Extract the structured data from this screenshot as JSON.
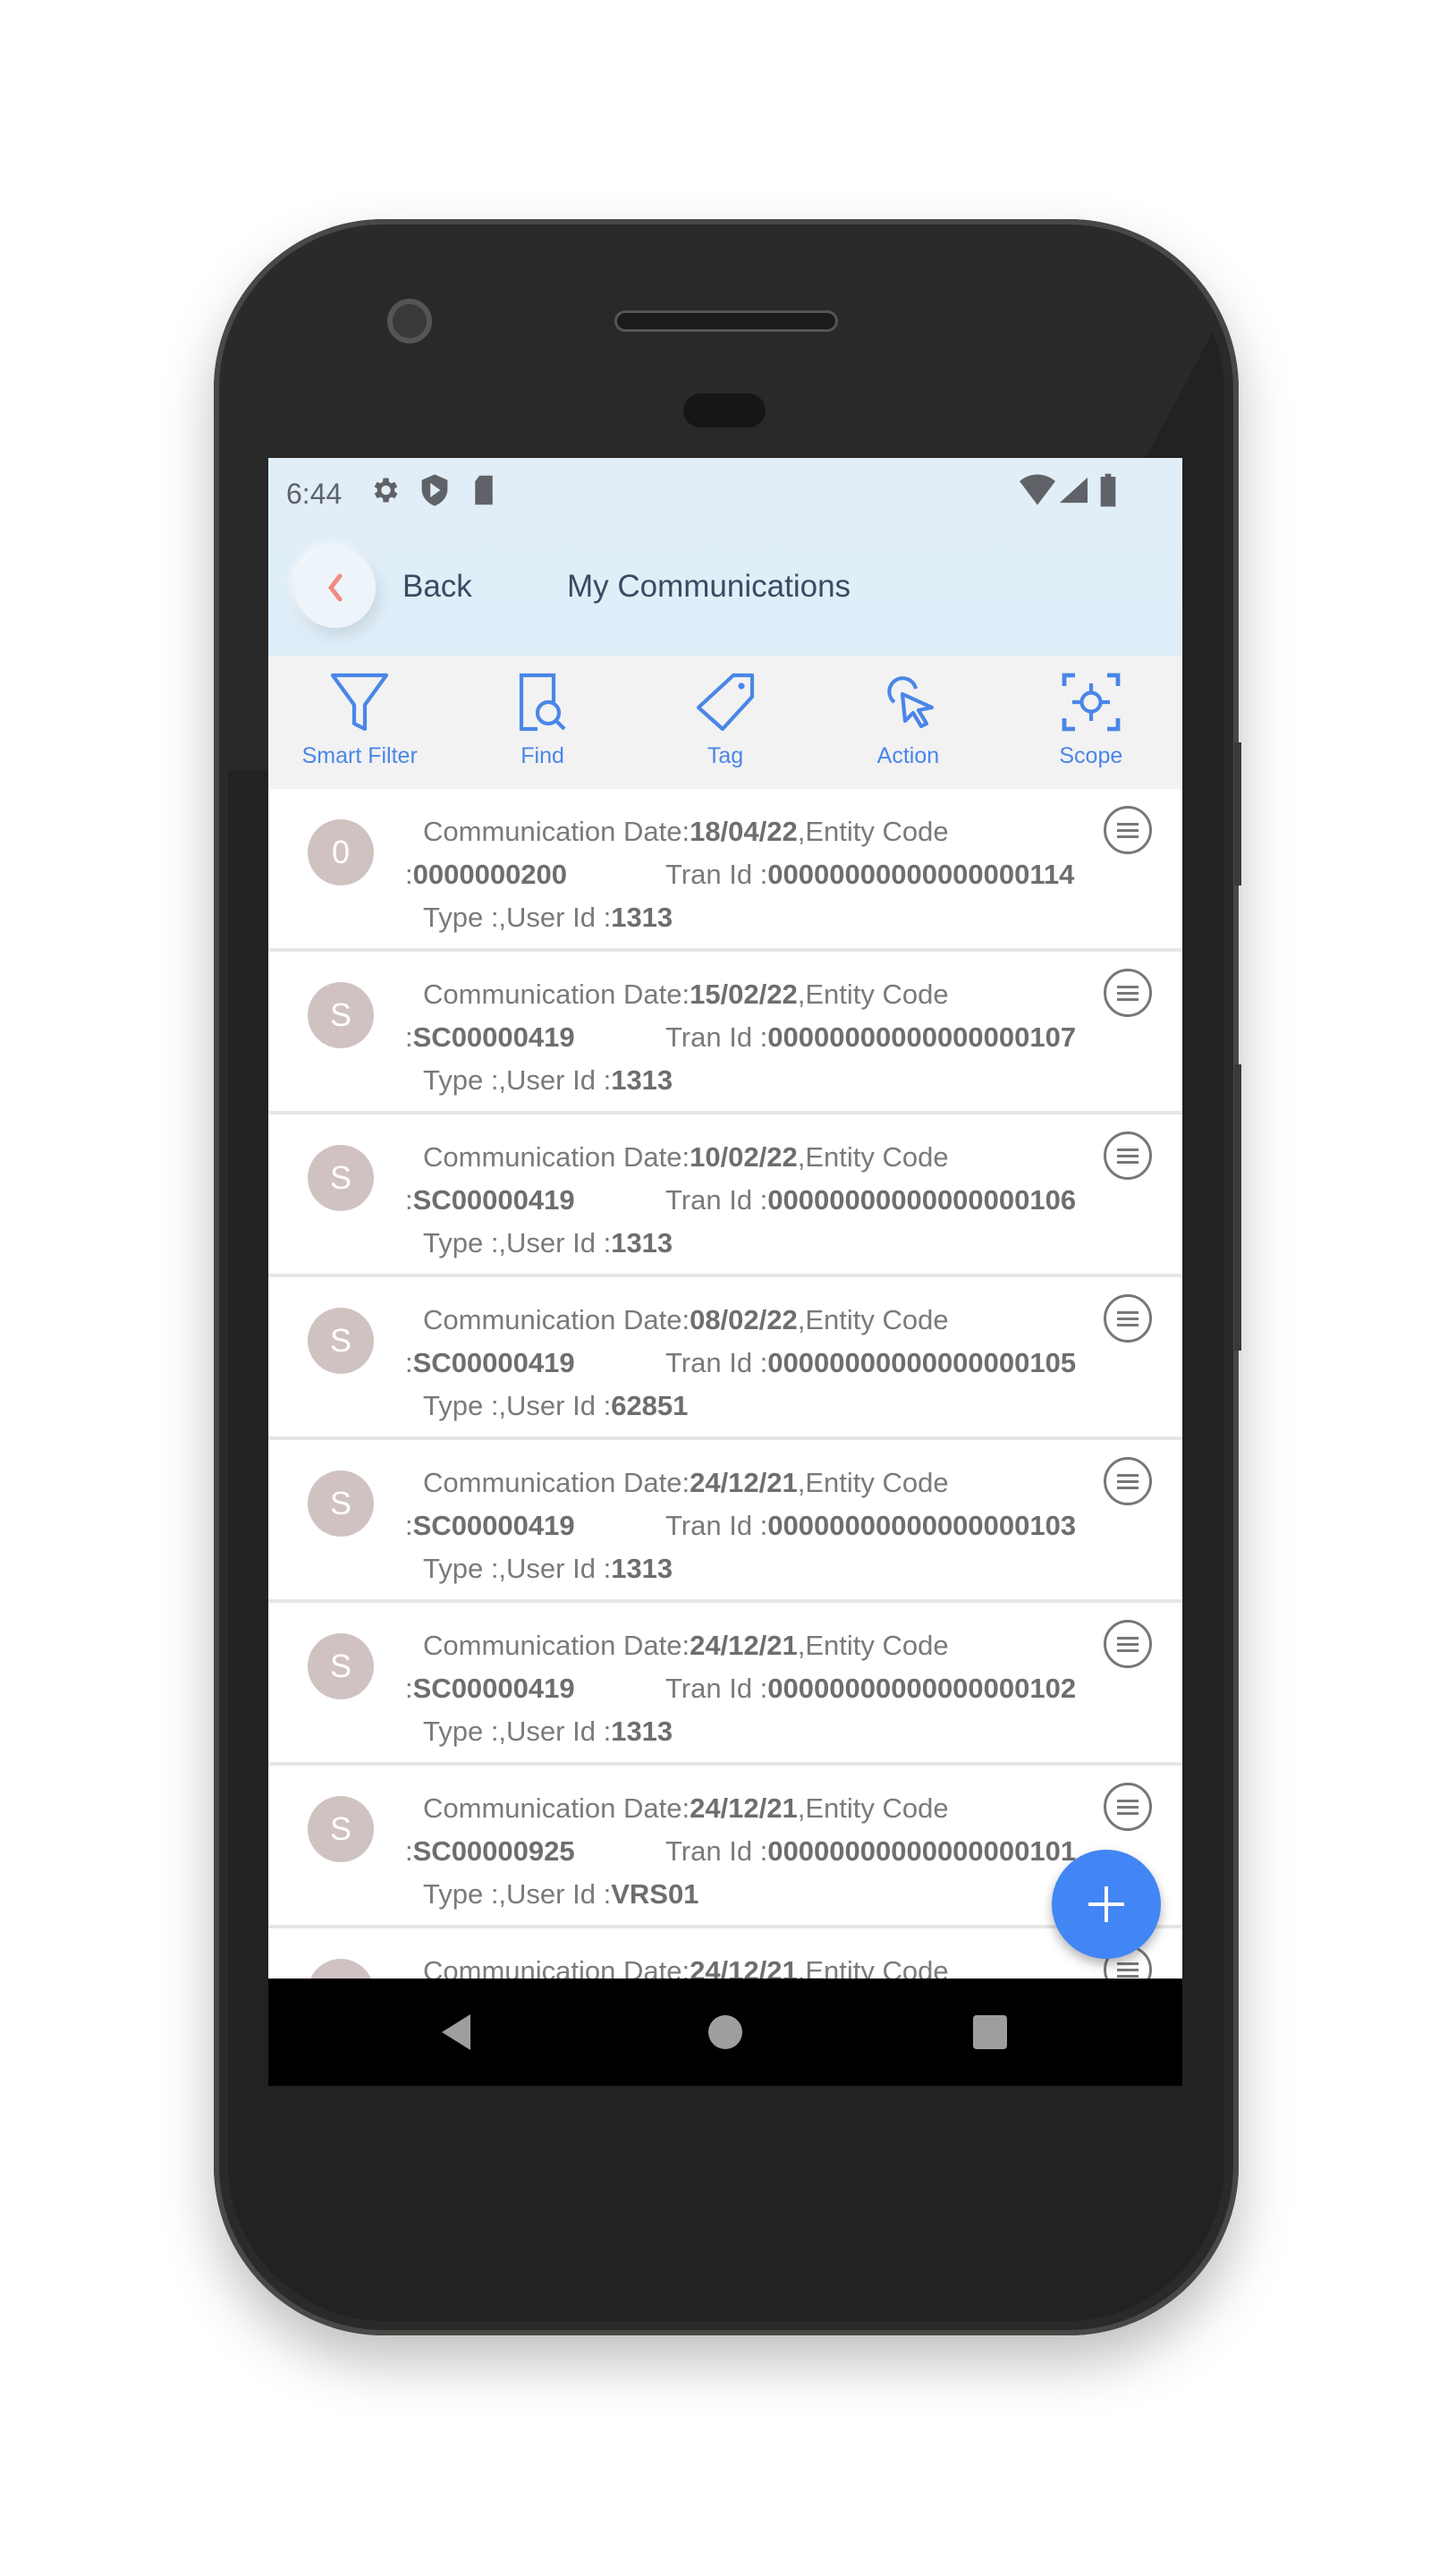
{
  "status_bar": {
    "time": "6:44",
    "left_icons": [
      "settings-icon",
      "shield-play-icon",
      "sd-card-icon"
    ],
    "right_icons": [
      "wifi-icon",
      "signal-icon",
      "battery-icon"
    ]
  },
  "header": {
    "back_label": "Back",
    "title": "My Communications"
  },
  "toolbar": [
    {
      "label": "Smart Filter",
      "icon": "funnel-icon"
    },
    {
      "label": "Find",
      "icon": "document-search-icon"
    },
    {
      "label": "Tag",
      "icon": "tag-icon"
    },
    {
      "label": "Action",
      "icon": "pointer-click-icon"
    },
    {
      "label": "Scope",
      "icon": "focus-target-icon"
    }
  ],
  "labels": {
    "date": "Communication Date:",
    "entity": ",Entity Code",
    "entity_prefix": ":",
    "tran": "Tran Id :",
    "type_user": "Type :,User Id :"
  },
  "rows": [
    {
      "avatar": "0",
      "date": "18/04/22",
      "entity_code": "0000000200",
      "tran_id": "00000000000000000114",
      "user_id": "1313"
    },
    {
      "avatar": "S",
      "date": "15/02/22",
      "entity_code": "SC00000419",
      "tran_id": "00000000000000000107",
      "user_id": "1313"
    },
    {
      "avatar": "S",
      "date": "10/02/22",
      "entity_code": "SC00000419",
      "tran_id": "00000000000000000106",
      "user_id": "1313"
    },
    {
      "avatar": "S",
      "date": "08/02/22",
      "entity_code": "SC00000419",
      "tran_id": "00000000000000000105",
      "user_id": "62851"
    },
    {
      "avatar": "S",
      "date": "24/12/21",
      "entity_code": "SC00000419",
      "tran_id": "00000000000000000103",
      "user_id": "1313"
    },
    {
      "avatar": "S",
      "date": "24/12/21",
      "entity_code": "SC00000419",
      "tran_id": "00000000000000000102",
      "user_id": "1313"
    },
    {
      "avatar": "S",
      "date": "24/12/21",
      "entity_code": "SC00000925",
      "tran_id": "00000000000000000101",
      "user_id": "VRS01"
    },
    {
      "avatar": "",
      "date": "24/12/21",
      "entity_code": "",
      "tran_id": "",
      "user_id": ""
    }
  ],
  "colors": {
    "accent": "#4285f4",
    "toolbar_icon": "#4a86e8",
    "header_bg": "#e1eef8",
    "avatar_bg": "#d1c2c2",
    "back_chevron": "#f28b82"
  }
}
